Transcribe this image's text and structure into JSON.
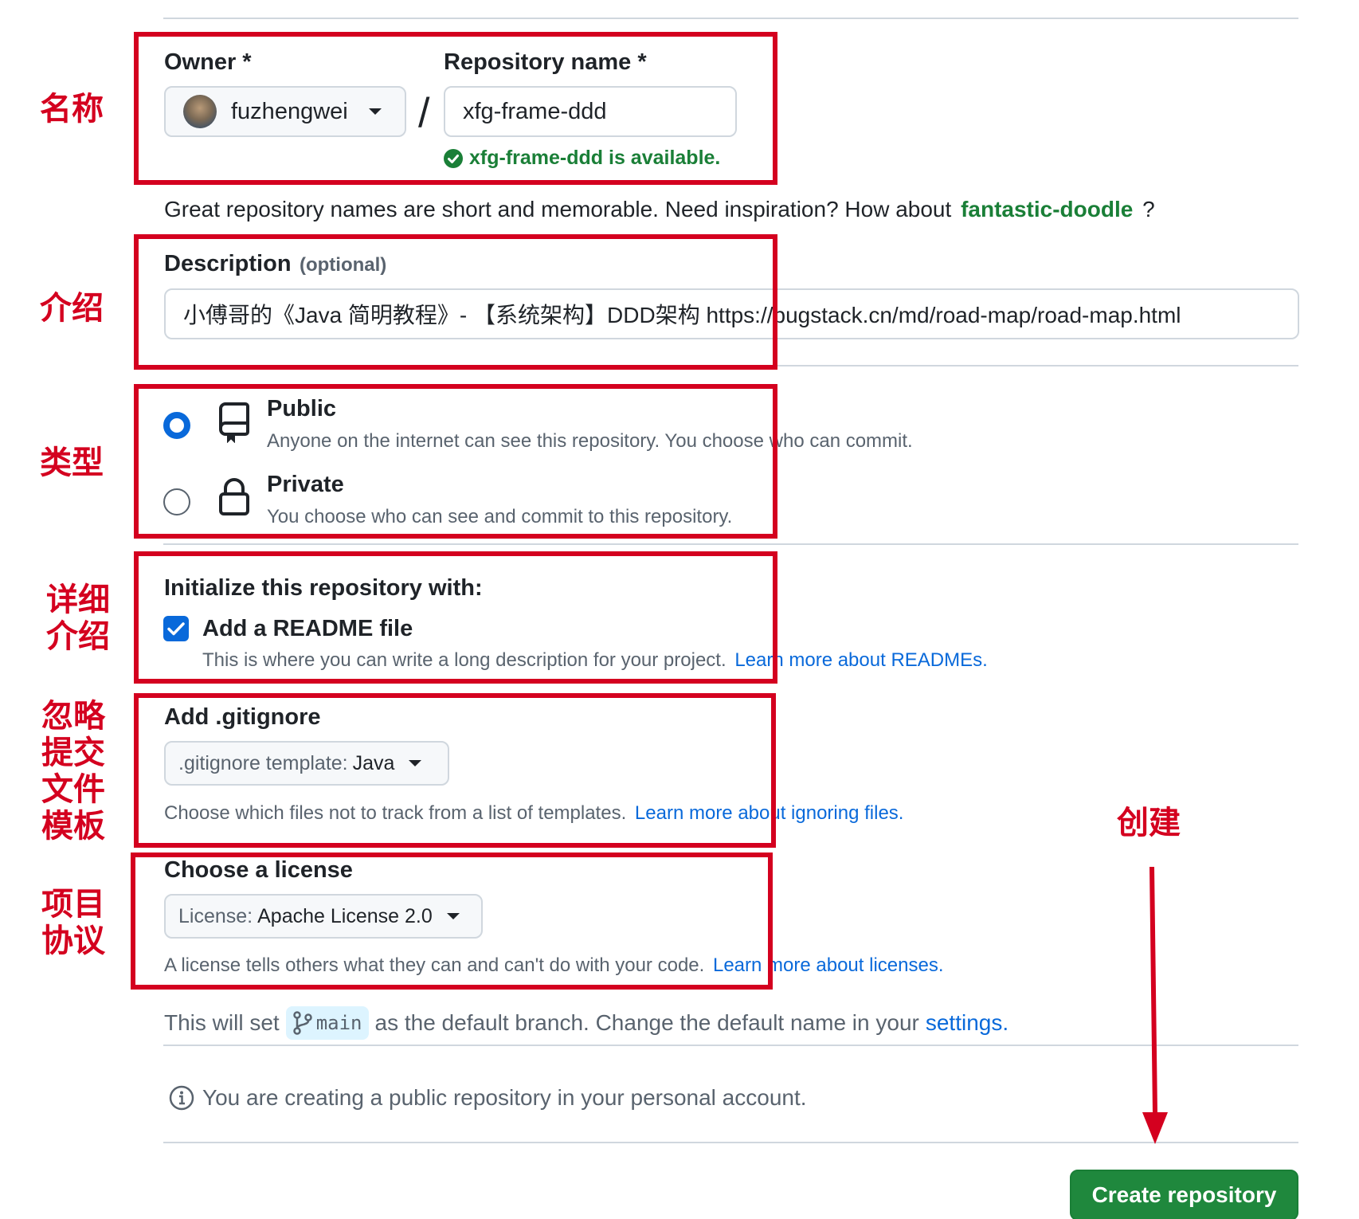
{
  "owner": {
    "label": "Owner *",
    "value": "fuzhengwei",
    "avatar_icon": "avatar"
  },
  "repo": {
    "label": "Repository name *",
    "separator": "/",
    "value": "xfg-frame-ddd",
    "status": "xfg-frame-ddd is available."
  },
  "hint": {
    "text": "Great repository names are short and memorable. Need inspiration? How about",
    "suggestion": "fantastic-doodle",
    "end": "?"
  },
  "description": {
    "label": "Description",
    "optional": "(optional)",
    "value": "小傅哥的《Java 简明教程》- 【系统架构】DDD架构 https://bugstack.cn/md/road-map/road-map.html"
  },
  "visibility": {
    "public_title": "Public",
    "public_desc": "Anyone on the internet can see this repository. You choose who can commit.",
    "private_title": "Private",
    "private_desc": "You choose who can see and commit to this repository.",
    "selected": "public"
  },
  "init": {
    "heading": "Initialize this repository with:",
    "readme_label": "Add a README file",
    "readme_checked": true,
    "readme_desc": "This is where you can write a long description for your project.",
    "readme_link": "Learn more about READMEs."
  },
  "gitignore": {
    "heading": "Add .gitignore",
    "select_prefix": ".gitignore template:",
    "select_value": "Java",
    "desc": "Choose which files not to track from a list of templates.",
    "link": "Learn more about ignoring files."
  },
  "license": {
    "heading": "Choose a license",
    "select_prefix": "License:",
    "select_value": "Apache License 2.0",
    "desc": "A license tells others what they can and can't do with your code.",
    "link": "Learn more about licenses."
  },
  "branch": {
    "prefix": "This will set",
    "name": "main",
    "suffix": "as the default branch. Change the default name in your",
    "link": "settings",
    "end": "."
  },
  "notice": "You are creating a public repository in your personal account.",
  "create_button": "Create repository",
  "annotations": {
    "name": "名称",
    "intro": "介绍",
    "type": "类型",
    "detail_1": "详细",
    "detail_2": "介绍",
    "ignore_1": "忽略",
    "ignore_2": "提交",
    "ignore_3": "文件",
    "ignore_4": "模板",
    "license_1": "项目",
    "license_2": "协议",
    "create": "创建"
  },
  "colors": {
    "accent_red": "#d4001f",
    "success_green": "#1a7f37",
    "link_blue": "#0969da",
    "create_button": "#1f883d"
  }
}
